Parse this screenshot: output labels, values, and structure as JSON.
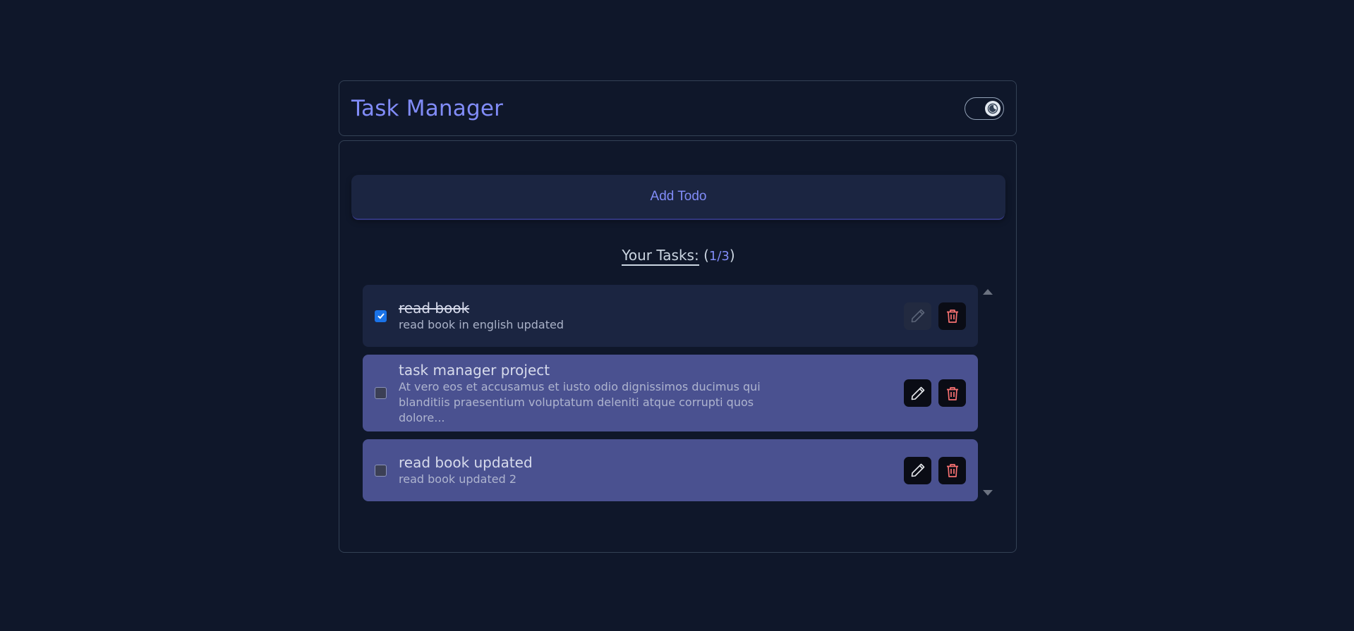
{
  "header": {
    "title": "Task Manager",
    "theme_toggle_icon": "moon-icon"
  },
  "add_button": {
    "label": "Add Todo"
  },
  "tasks_heading": {
    "label": "Your Tasks:",
    "open_paren": "(",
    "count": "1/3",
    "close_paren": ")"
  },
  "tasks": [
    {
      "title": "read book",
      "description": "read book in english updated",
      "completed": true
    },
    {
      "title": "task manager project",
      "description": "At vero eos et accusamus et iusto odio dignissimos ducimus qui blanditiis praesentium voluptatum deleniti atque corrupti quos dolore...",
      "completed": false
    },
    {
      "title": "read book updated",
      "description": "read book updated 2",
      "completed": false
    }
  ],
  "colors": {
    "background": "#0f172a",
    "accent": "#818cf8",
    "task_open_bg": "#4a5190",
    "task_done_bg": "#1b2541",
    "delete_icon": "#f87171",
    "checkbox_checked": "#1a73e8"
  }
}
